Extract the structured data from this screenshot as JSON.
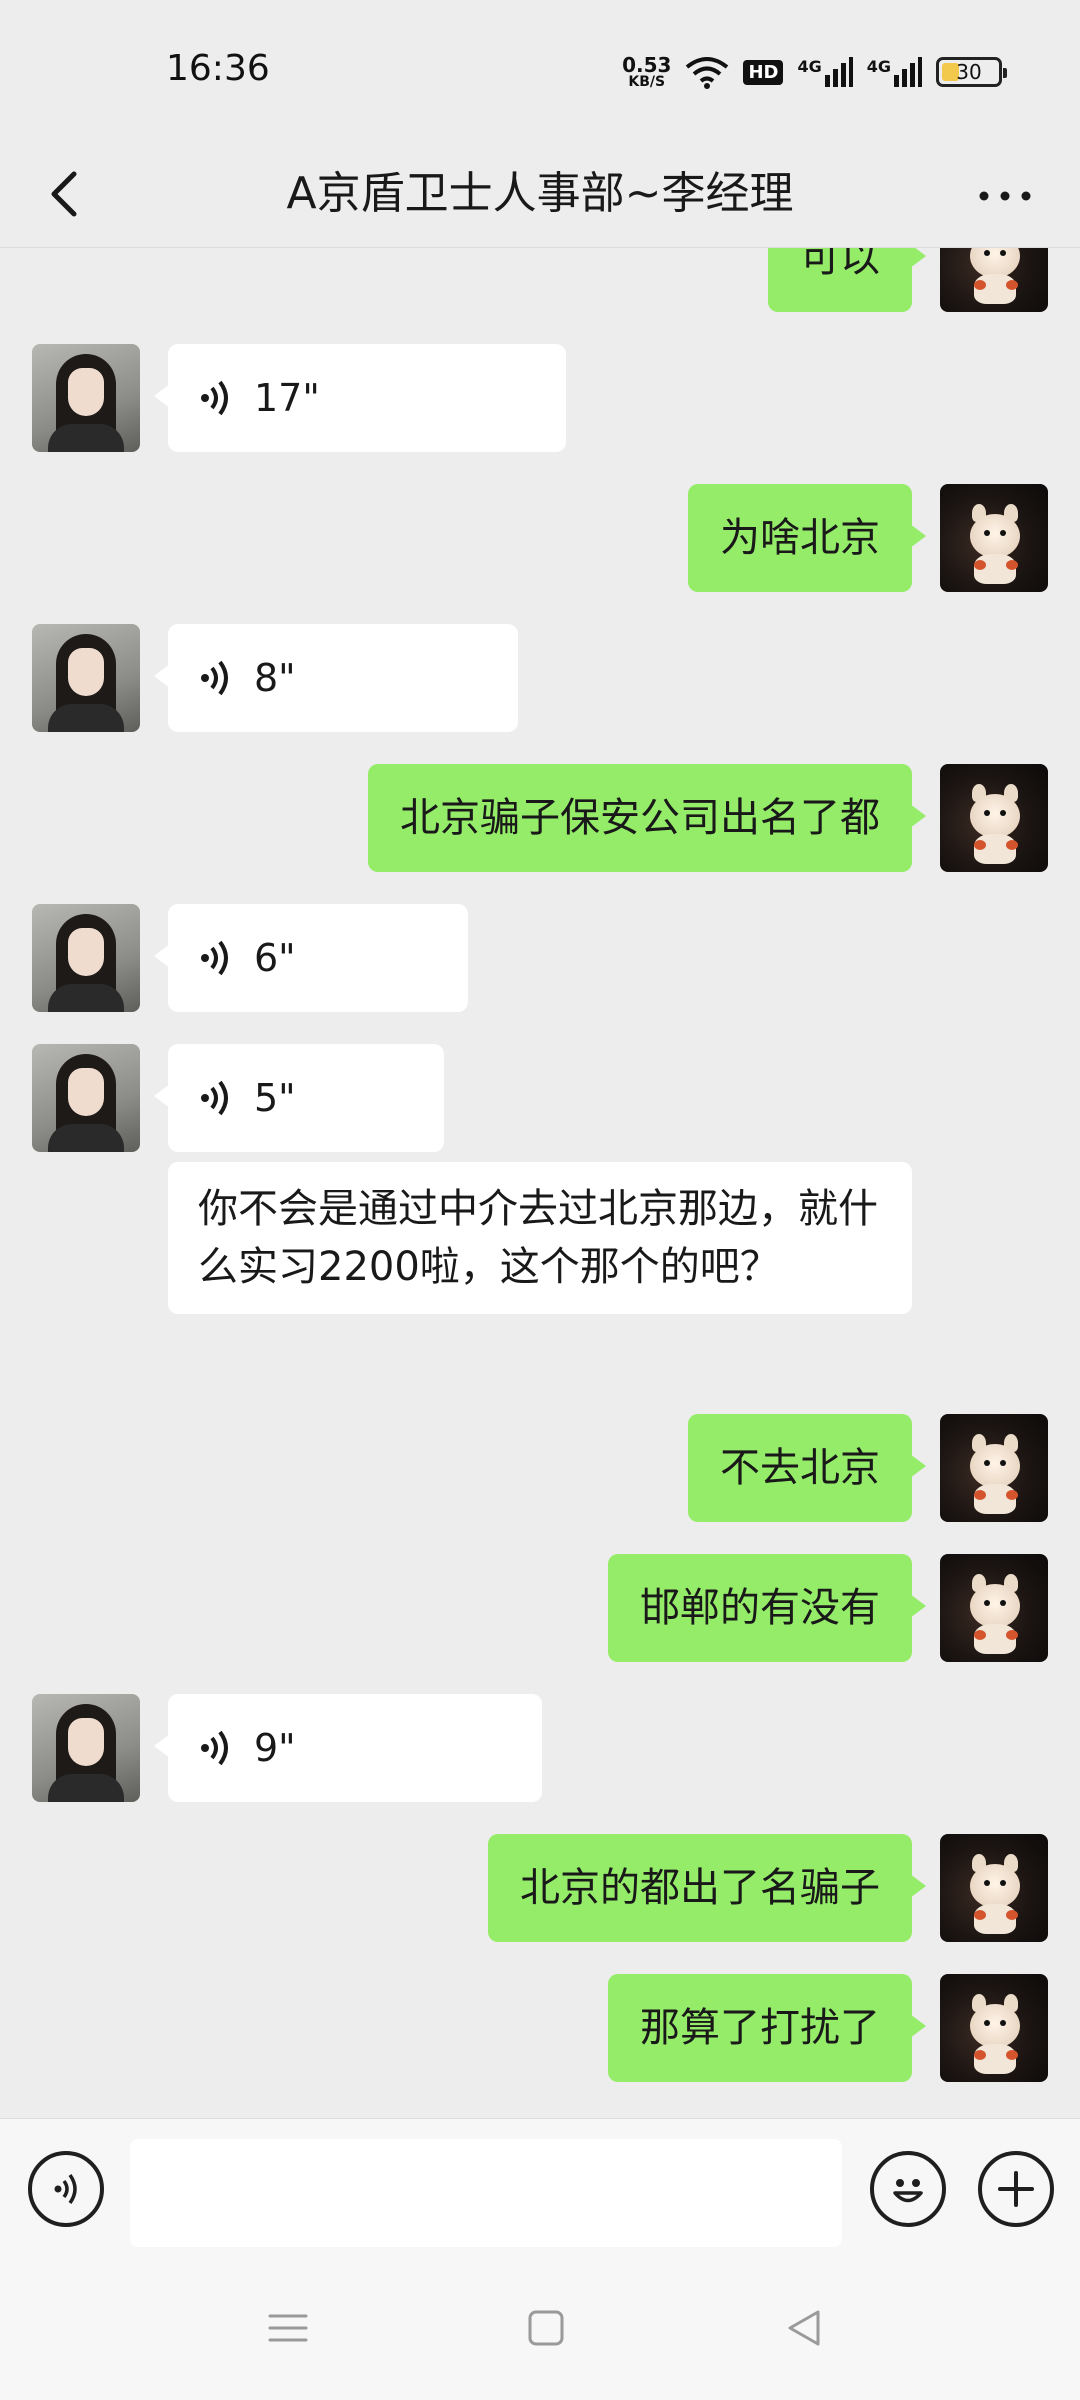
{
  "status_bar": {
    "time": "16:36",
    "net_speed_value": "0.53",
    "net_speed_unit": "KB/S",
    "hd_badge": "HD",
    "signal_1": "4G",
    "signal_2": "4G",
    "battery": "30"
  },
  "header": {
    "title": "A京盾卫士人事部~李经理",
    "back_icon": "chevron-left-icon",
    "more_icon": "more-dots-icon"
  },
  "messages": [
    {
      "side": "me",
      "type": "text",
      "text": "可以"
    },
    {
      "side": "them",
      "type": "voice",
      "duration": "17\""
    },
    {
      "side": "me",
      "type": "text",
      "text": "为啥北京"
    },
    {
      "side": "them",
      "type": "voice",
      "duration": "8\""
    },
    {
      "side": "me",
      "type": "text",
      "text": "北京骗子保安公司出名了都"
    },
    {
      "side": "them",
      "type": "voice",
      "duration": "6\""
    },
    {
      "side": "them",
      "type": "voice",
      "duration": "5\""
    },
    {
      "side": "them",
      "type": "text",
      "text": "你不会是通过中介去过北京那边，就什么实习2200啦，这个那个的吧？"
    },
    {
      "side": "me",
      "type": "text",
      "text": "不去北京"
    },
    {
      "side": "me",
      "type": "text",
      "text": "邯郸的有没有"
    },
    {
      "side": "them",
      "type": "voice",
      "duration": "9\""
    },
    {
      "side": "me",
      "type": "text",
      "text": "北京的都出了名骗子"
    },
    {
      "side": "me",
      "type": "text",
      "text": "那算了打扰了"
    }
  ],
  "input_bar": {
    "voice_icon": "voice-mode-icon",
    "emoji_icon": "emoji-icon",
    "plus_icon": "plus-icon",
    "value": ""
  },
  "nav_bar": {
    "menu_icon": "menu-icon",
    "home_icon": "home-icon",
    "back_icon": "back-triangle-icon"
  }
}
